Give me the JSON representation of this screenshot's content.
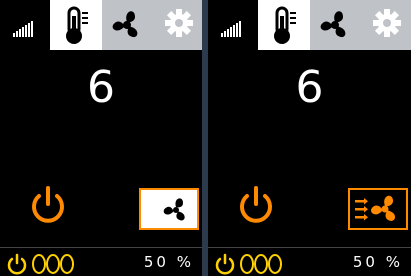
{
  "panels": [
    {
      "speed": "6",
      "mode_icon": "fan-icon",
      "status": {
        "percent": "50 %"
      }
    },
    {
      "speed": "6",
      "mode_icon": "airflow-fan-icon",
      "status": {
        "percent": "50 %"
      }
    }
  ],
  "tabs": [
    "signal-icon",
    "thermometer-icon",
    "fan-icon",
    "gear-icon"
  ],
  "colors": {
    "accent": "#ff8a00",
    "panel_bg": "#000000",
    "tab_active": "#ffffff",
    "tab_inactive": "#bfc3c7"
  }
}
